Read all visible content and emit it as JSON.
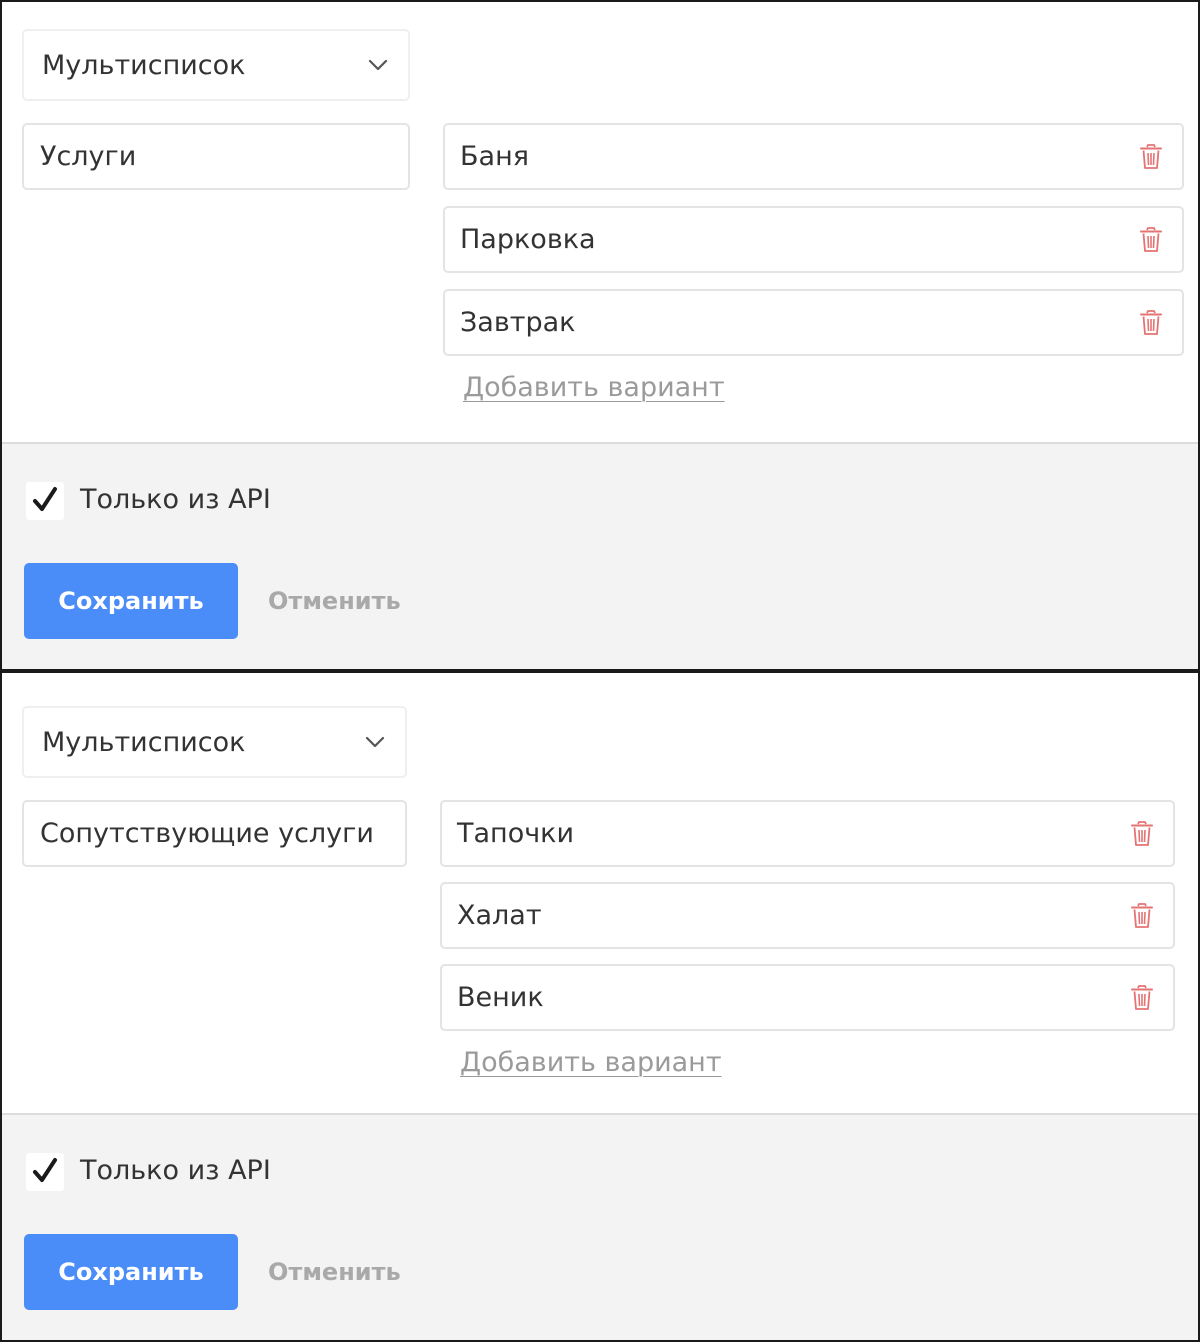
{
  "forms": [
    {
      "field_type": "Мультисписок",
      "field_name": "Услуги",
      "options": [
        "Баня",
        "Парковка",
        "Завтрак"
      ],
      "add_option_label": "Добавить вариант",
      "only_api_label": "Только из API",
      "only_api_checked": true,
      "save_label": "Сохранить",
      "cancel_label": "Отменить"
    },
    {
      "field_type": "Мультисписок",
      "field_name": "Сопутствующие услуги",
      "options": [
        "Тапочки",
        "Халат",
        "Веник"
      ],
      "add_option_label": "Добавить вариант",
      "only_api_label": "Только из API",
      "only_api_checked": true,
      "save_label": "Сохранить",
      "cancel_label": "Отменить"
    }
  ],
  "icons": {
    "dropdown": "chevron-down-icon",
    "delete": "trash-icon",
    "check": "checkmark-icon"
  },
  "colors": {
    "primary_button": "#4a8df8",
    "delete_icon": "#e57373",
    "link": "#9a9a9a",
    "footer_bg": "#f3f3f3"
  }
}
